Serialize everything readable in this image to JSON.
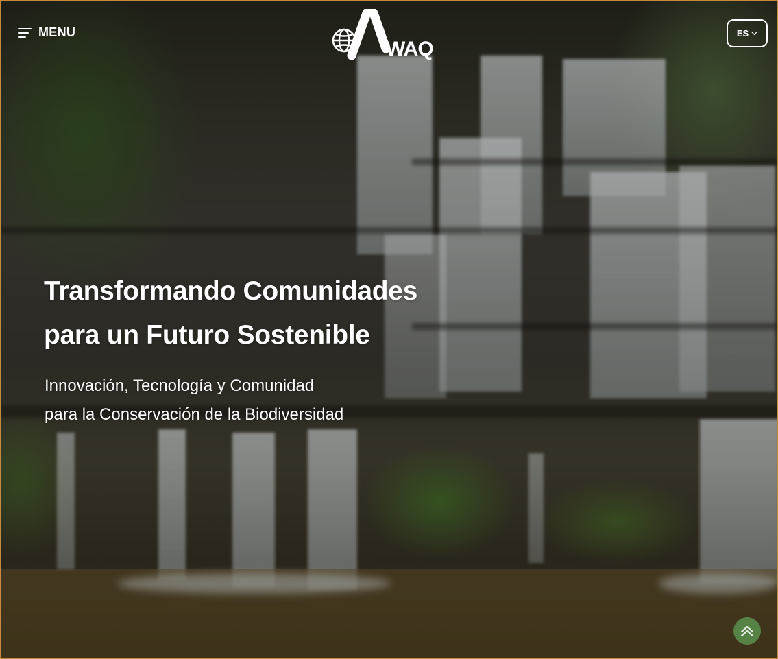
{
  "header": {
    "menu_label": "MENU",
    "logo_text": "AWAQ",
    "language": "ES"
  },
  "hero": {
    "title_line1": "Transformando Comunidades",
    "title_line2": "para un Futuro Sostenible",
    "subtitle_line1": "Innovación, Tecnología y Comunidad",
    "subtitle_line2": "para la Conservación de la Biodiversidad"
  },
  "icons": {
    "menu": "menu-icon",
    "logo_globe": "globe-icon",
    "language_chevron": "chevron-down-icon",
    "scroll_top": "chevron-up-icon"
  },
  "colors": {
    "text": "#ffffff",
    "scroll_button": "#5c9650",
    "frame_border": "#c78a3c"
  }
}
